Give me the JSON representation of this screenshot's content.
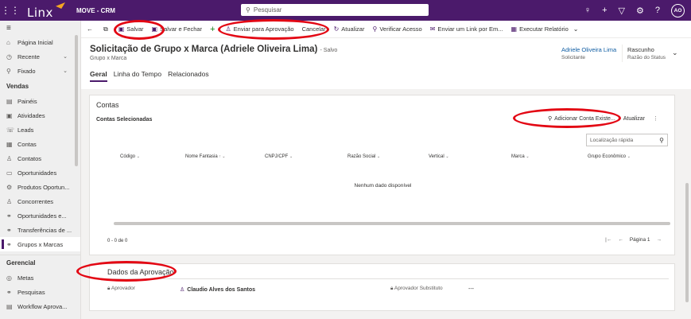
{
  "topbar": {
    "logo": "Linx",
    "app_name": "MOVE - CRM",
    "search_placeholder": "Pesquisar",
    "avatar_initials": "AO"
  },
  "sidebar": {
    "items_top": [
      {
        "label": "Página Inicial",
        "icon": "home-icon"
      },
      {
        "label": "Recente",
        "icon": "clock-icon",
        "chevron": true
      },
      {
        "label": "Fixado",
        "icon": "pin-icon",
        "chevron": true
      }
    ],
    "section_vendas": "Vendas",
    "items_vendas": [
      {
        "label": "Painéis",
        "icon": "dashboard-icon"
      },
      {
        "label": "Atividades",
        "icon": "clipboard-icon"
      },
      {
        "label": "Leads",
        "icon": "phone-icon"
      },
      {
        "label": "Contas",
        "icon": "building-icon"
      },
      {
        "label": "Contatos",
        "icon": "person-icon"
      },
      {
        "label": "Oportunidades",
        "icon": "document-icon"
      },
      {
        "label": "Produtos Oportun...",
        "icon": "gear-icon"
      },
      {
        "label": "Concorrentes",
        "icon": "person-icon"
      },
      {
        "label": "Oportunidades e...",
        "icon": "link-icon"
      },
      {
        "label": "Transferências de ...",
        "icon": "link-icon"
      },
      {
        "label": "Grupos x Marcas",
        "icon": "link-icon",
        "active": true
      }
    ],
    "section_gerencial": "Gerencial",
    "items_gerencial": [
      {
        "label": "Metas",
        "icon": "target-icon"
      },
      {
        "label": "Pesquisas",
        "icon": "link-icon"
      },
      {
        "label": "Workflow Aprova...",
        "icon": "table-icon"
      }
    ]
  },
  "commandbar": {
    "salvar": "Salvar",
    "salvar_fechar": "Salvar e Fechar",
    "enviar_aprovacao": "Enviar para Aprovação",
    "cancelar": "Cancelar",
    "atualizar": "Atualizar",
    "verificar_acesso": "Verificar Acesso",
    "enviar_link": "Enviar um Link por Em...",
    "executar_relatorio": "Executar Relatório"
  },
  "header": {
    "title": "Solicitação de Grupo x Marca (Adriele Oliveira Lima)",
    "saved": "- Salvo",
    "entity": "Grupo x Marca",
    "owner_value": "Adriele Oliveira Lima",
    "owner_label": "Solicitante",
    "status_value": "Rascunho",
    "status_label": "Razão do Status"
  },
  "tabs": [
    "Geral",
    "Linha do Tempo",
    "Relacionados"
  ],
  "contas": {
    "title": "Contas",
    "subgrid_title": "Contas Selecionadas",
    "add_button": "Adicionar Conta Existe...",
    "refresh_button": "Atualizar",
    "quickfind_placeholder": "Localização rápida",
    "columns": [
      "Código",
      "Nome Fantasia",
      "CNPJ/CPF",
      "Razão Social",
      "Vertical",
      "Marca",
      "Grupo Econômico"
    ],
    "empty_text": "Nenhum dado disponível",
    "record_count": "0 - 0 de 0",
    "page_label": "Página 1"
  },
  "aprovacao": {
    "title": "Dados da Aprovação",
    "aprovador_label": "Aprovador",
    "aprovador_value": "Claudio Alves dos Santos",
    "substituto_label": "Aprovador Substituto",
    "substituto_value": "---"
  },
  "colors": {
    "brand": "#4b1a6b",
    "annotation": "#e30613",
    "link": "#115ea3"
  }
}
